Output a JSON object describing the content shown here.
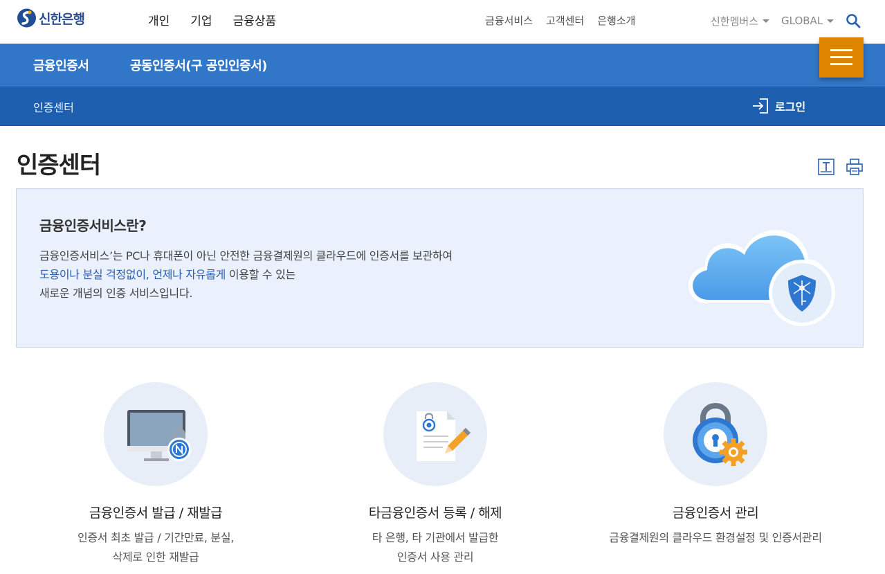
{
  "header": {
    "logo_text": "신한은행",
    "gnb": [
      "개인",
      "기업",
      "금융상품"
    ],
    "util": [
      "금융서비스",
      "고객센터",
      "은행소개"
    ],
    "members": "신한멤버스",
    "global": "GLOBAL"
  },
  "nav": {
    "items": [
      "금융인증서",
      "공동인증서(구 공인인증서)"
    ],
    "breadcrumb": "인증센터",
    "login": "로그인"
  },
  "page": {
    "title": "인증센터"
  },
  "intro": {
    "title": "금융인증서비스란?",
    "line1": "금융인증서비스’는 PC나 휴대폰이 아닌 안전한 금융결제원의 클라우드에 인증서를 보관하여",
    "line2_highlight": "도용이나 분실 걱정없이, 언제나 자유롭게",
    "line2_rest": " 이용할 수 있는",
    "line3": "새로운 개념의 인증 서비스입니다."
  },
  "cards": [
    {
      "title": "금융인증서 발급 / 재발급",
      "desc1": "인증서 최초 발급 / 기간만료, 분실,",
      "desc2": "삭제로 인한 재발급"
    },
    {
      "title": "타금융인증서 등록 / 해제",
      "desc1": "타 은행, 타 기관에서 발급한",
      "desc2": "인증서 사용 관리"
    },
    {
      "title": "금융인증서 관리",
      "desc1": "금융결제원의 클라우드 환경설정 및 인증서관리",
      "desc2": ""
    }
  ],
  "colors": {
    "nav_primary": "#3276c8",
    "nav_secondary": "#1d5fae",
    "menu_button": "#dd8500",
    "intro_bg": "#eaf1fd",
    "highlight": "#2c5fb5"
  }
}
